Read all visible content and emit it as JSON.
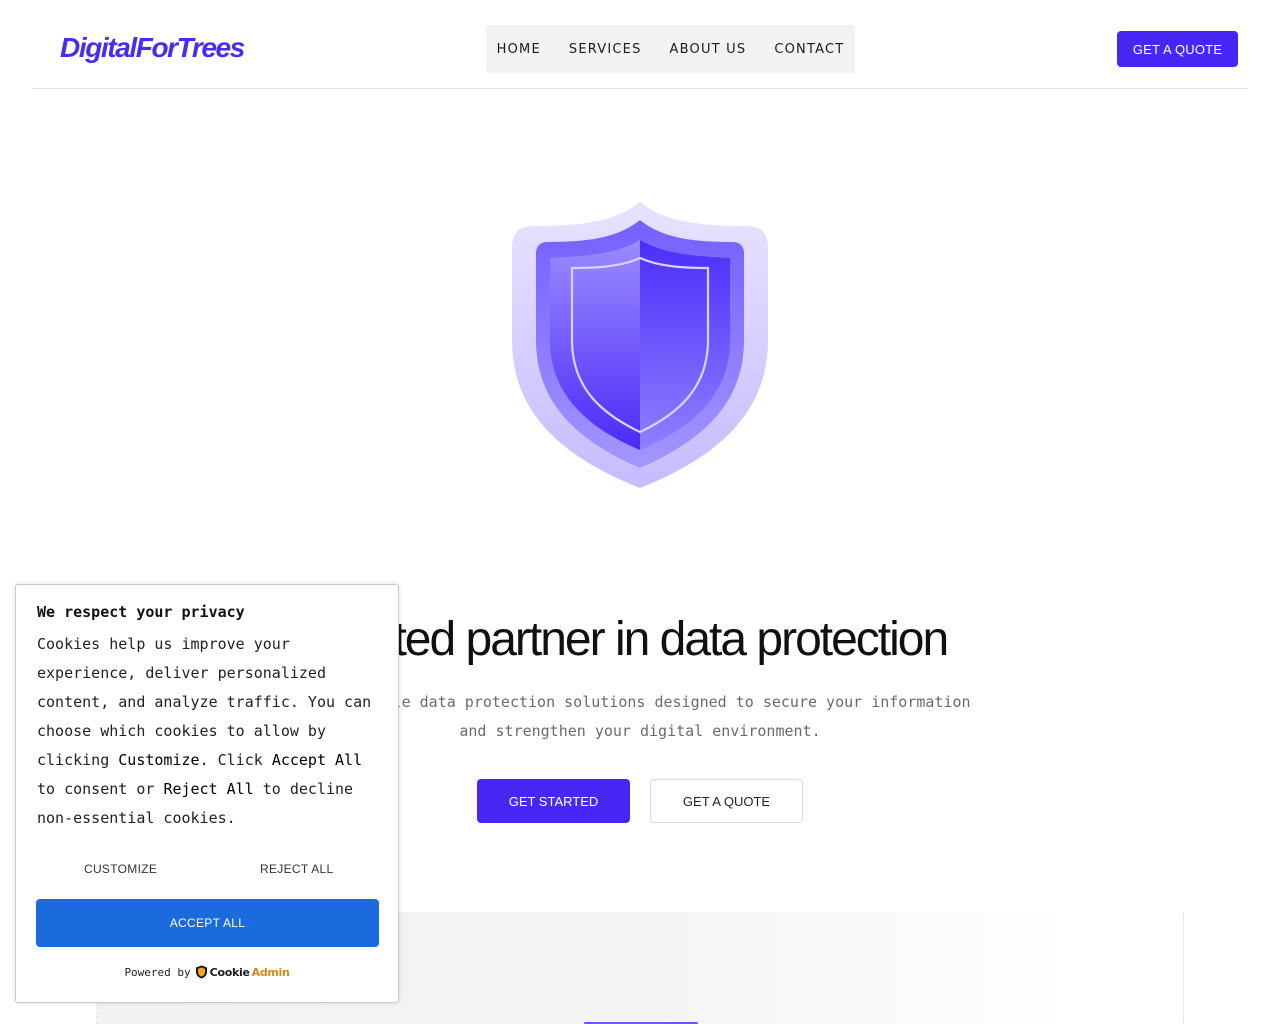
{
  "header": {
    "logo": "DigitalForTrees",
    "nav": [
      "HOME",
      "SERVICES",
      "ABOUT US",
      "CONTACT"
    ],
    "cta": "GET A QUOTE"
  },
  "hero": {
    "icon": "shield-icon",
    "title": "rusted partner in data protection",
    "subtitle_line1": "iable data protection solutions designed to secure your information",
    "subtitle_line2": "and strengthen your digital environment.",
    "primary_button": "GET STARTED",
    "secondary_button": "GET A QUOTE"
  },
  "cookie": {
    "title": "We respect your privacy",
    "body_parts": [
      "Cookies help us improve your experience, deliver personalized content, and analyze traffic. You can choose which cookies to allow by clicking ",
      "Customize",
      ". Click ",
      "Accept All",
      " to consent or ",
      "Reject All",
      " to decline non-essential cookies."
    ],
    "customize": "CUSTOMIZE",
    "reject_all": "REJECT ALL",
    "accept_all": "ACCEPT ALL",
    "powered_by": "Powered by",
    "brand_part1": "Cookie",
    "brand_part2": "Admin"
  },
  "colors": {
    "brand": "#4627f4",
    "accept": "#1c6bde"
  }
}
